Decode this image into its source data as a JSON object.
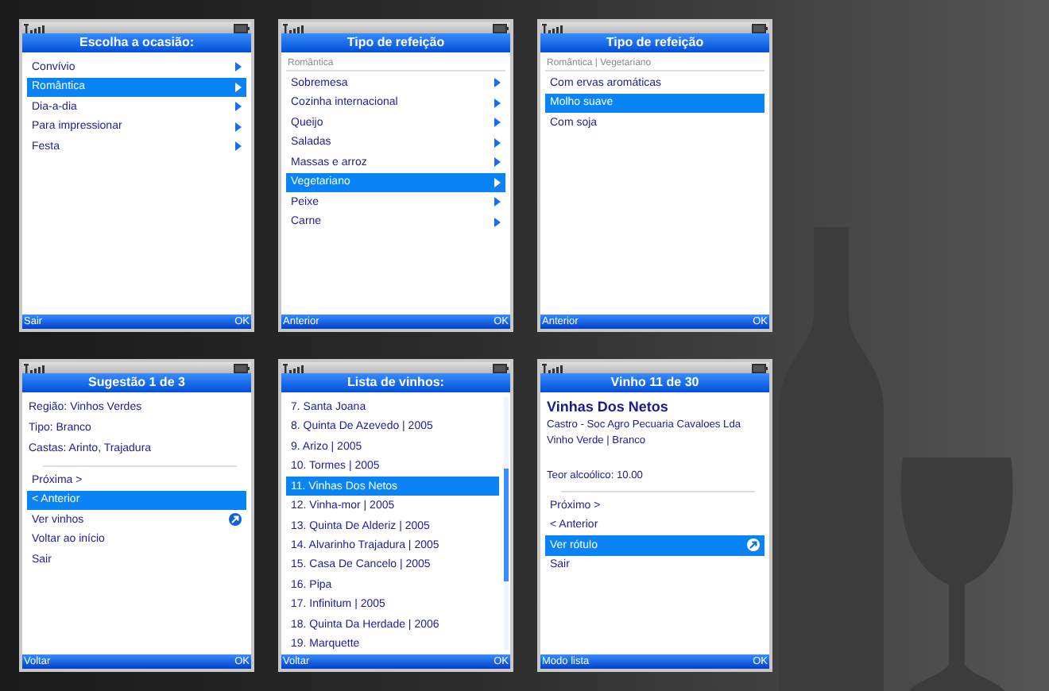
{
  "screens": [
    {
      "title": "Escolha a ocasião:",
      "left_softkey": "Sair",
      "right_softkey": "OK",
      "scrollbar": false,
      "items": [
        {
          "kind": "menu",
          "text": "Convívio",
          "selected": false
        },
        {
          "kind": "menu",
          "text": "Romântica",
          "selected": true
        },
        {
          "kind": "menu",
          "text": "Dia-a-dia",
          "selected": false
        },
        {
          "kind": "menu",
          "text": "Para impressionar",
          "selected": false
        },
        {
          "kind": "menu",
          "text": "Festa",
          "selected": false
        }
      ]
    },
    {
      "title": "Tipo de refeição",
      "left_softkey": "Anterior",
      "right_softkey": "OK",
      "scrollbar": false,
      "items": [
        {
          "kind": "breadcrumb",
          "text": "Romântica"
        },
        {
          "kind": "menu",
          "text": "Sobremesa",
          "selected": false
        },
        {
          "kind": "menu",
          "text": "Cozinha internacional",
          "selected": false
        },
        {
          "kind": "menu",
          "text": "Queijo",
          "selected": false
        },
        {
          "kind": "menu",
          "text": "Saladas",
          "selected": false
        },
        {
          "kind": "menu",
          "text": "Massas e arroz",
          "selected": false
        },
        {
          "kind": "menu",
          "text": "Vegetariano",
          "selected": true
        },
        {
          "kind": "menu",
          "text": "Peixe",
          "selected": false
        },
        {
          "kind": "menu",
          "text": "Carne",
          "selected": false
        }
      ]
    },
    {
      "title": "Tipo de refeição",
      "left_softkey": "Anterior",
      "right_softkey": "OK",
      "scrollbar": false,
      "items": [
        {
          "kind": "breadcrumb",
          "text": "Romântica | Vegetariano"
        },
        {
          "kind": "option",
          "text": "Com ervas aromáticas",
          "selected": false
        },
        {
          "kind": "option",
          "text": "Molho suave",
          "selected": true
        },
        {
          "kind": "option",
          "text": "Com soja",
          "selected": false
        }
      ]
    },
    {
      "title": "Sugestão 1 de 3",
      "left_softkey": "Voltar",
      "right_softkey": "OK",
      "scrollbar": false,
      "items": [
        {
          "kind": "info",
          "text": "Região: Vinhos Verdes"
        },
        {
          "kind": "info",
          "text": "Tipo: Branco"
        },
        {
          "kind": "info",
          "text": "Castas: Arinto, Trajadura"
        },
        {
          "kind": "separator"
        },
        {
          "kind": "option",
          "text": "Próxima >",
          "selected": false
        },
        {
          "kind": "option",
          "text": "< Anterior",
          "selected": true
        },
        {
          "kind": "link",
          "text": "Ver vinhos",
          "selected": false
        },
        {
          "kind": "option",
          "text": "Voltar ao início",
          "selected": false
        },
        {
          "kind": "option",
          "text": "Sair",
          "selected": false
        }
      ]
    },
    {
      "title": "Lista de vinhos:",
      "left_softkey": "Voltar",
      "right_softkey": "OK",
      "scrollbar": true,
      "items": [
        {
          "kind": "option",
          "text": "7. Santa Joana",
          "selected": false
        },
        {
          "kind": "option",
          "text": "8. Quinta De Azevedo | 2005",
          "selected": false
        },
        {
          "kind": "option",
          "text": "9. Arizo | 2005",
          "selected": false
        },
        {
          "kind": "option",
          "text": "10. Tormes | 2005",
          "selected": false
        },
        {
          "kind": "option",
          "text": "11. Vinhas Dos Netos",
          "selected": true
        },
        {
          "kind": "option",
          "text": "12. Vinha-mor | 2005",
          "selected": false
        },
        {
          "kind": "option",
          "text": "13. Quinta De Alderiz | 2005",
          "selected": false
        },
        {
          "kind": "option",
          "text": "14. Alvarinho Trajadura | 2005",
          "selected": false
        },
        {
          "kind": "option",
          "text": "15. Casa De Cancelo | 2005",
          "selected": false
        },
        {
          "kind": "option",
          "text": "16. Pipa",
          "selected": false
        },
        {
          "kind": "option",
          "text": "17. Infinitum | 2005",
          "selected": false
        },
        {
          "kind": "option",
          "text": "18. Quinta Da Herdade | 2006",
          "selected": false
        },
        {
          "kind": "option",
          "text": "19. Marquette",
          "selected": false
        }
      ]
    },
    {
      "title": "Vinho 11 de 30",
      "left_softkey": "Modo lista",
      "right_softkey": "OK",
      "scrollbar": false,
      "items": [
        {
          "kind": "heading",
          "text": "Vinhas Dos Netos"
        },
        {
          "kind": "detail",
          "text": "Castro - Soc Agro Pecuaria Cavaloes Lda"
        },
        {
          "kind": "detail",
          "text": "Vinho Verde | Branco"
        },
        {
          "kind": "gap"
        },
        {
          "kind": "detail",
          "text": "Teor alcoólico: 10.00"
        },
        {
          "kind": "separator"
        },
        {
          "kind": "option",
          "text": "Próximo >",
          "selected": false
        },
        {
          "kind": "option",
          "text": "< Anterior",
          "selected": false
        },
        {
          "kind": "link",
          "text": "Ver rótulo",
          "selected": true
        },
        {
          "kind": "option",
          "text": "Sair",
          "selected": false
        }
      ]
    }
  ]
}
